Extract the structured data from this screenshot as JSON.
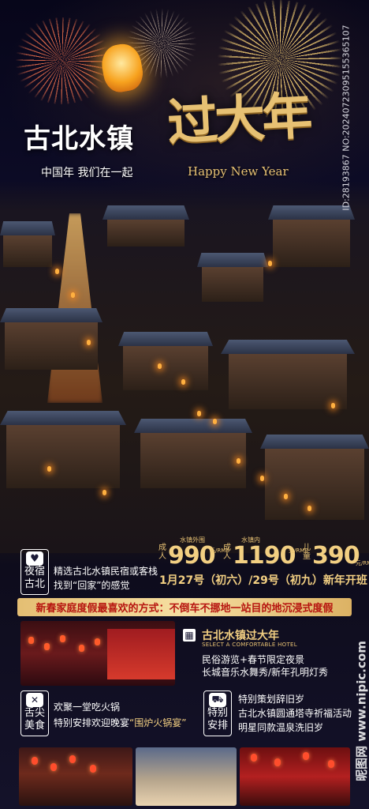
{
  "header": {
    "title": "古北水镇",
    "title_gold": "过大年",
    "slogan": "中国年 我们在一起",
    "slogan_en": "Happy New Year",
    "id_text": "ID:28193867 NO:20240723095155365107"
  },
  "stay": {
    "icon": "heart-icon",
    "label": "夜宿古北",
    "lines": [
      "精选古北水镇民宿或客栈",
      "找到“回家”的感觉"
    ]
  },
  "pricing": {
    "outside": {
      "caption": "水镇外围",
      "tag": "成人",
      "price": "990",
      "unit": "元/RMB"
    },
    "inside": {
      "caption": "水镇内",
      "tag": "成人",
      "price": "1190",
      "unit": "元/RMB"
    },
    "child": {
      "tag": "儿童",
      "price": "390",
      "unit": "元/RMB"
    }
  },
  "dates": "1月27号（初六）/29号（初九）新年开班",
  "highlight_banner": "新春家庭度假最喜欢的方式：不倒车不挪地一站目的地沉浸式度假",
  "hotel": {
    "icon": "building-icon",
    "title": "古北水镇过大年",
    "subtitle": "SELECT A COMFORTABLE HOTEL",
    "lines": [
      "民俗游览+春节限定夜景",
      "长城音乐水舞秀/新年孔明灯秀"
    ]
  },
  "food": {
    "icon": "dining-icon",
    "label": "舌尖美食",
    "line1": "欢聚一堂吃火锅",
    "line2_prefix": "特别安排欢迎晚宴",
    "line2_quote": "“围炉火锅宴”"
  },
  "special": {
    "icon": "car-icon",
    "label": "特别安排",
    "lines": [
      "特别策划辞旧岁",
      "古北水镇圆通塔寺祈福活动",
      "明星同款温泉洗旧岁"
    ]
  },
  "watermark": "昵图网 www.nipic.com"
}
